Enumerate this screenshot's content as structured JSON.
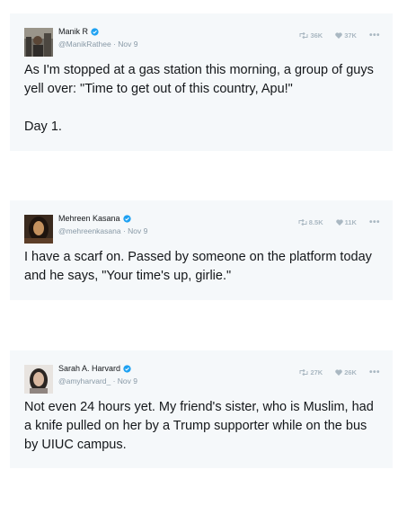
{
  "tweets": [
    {
      "name": "Manik R",
      "handle": "@ManikRathee",
      "date": "Nov 9",
      "retweets": "36K",
      "likes": "37K",
      "text": "As I'm stopped at a gas station this morning, a group of guys yell over: \"Time to get out of this country, Apu!\"\n\nDay 1."
    },
    {
      "name": "Mehreen Kasana",
      "handle": "@mehreenkasana",
      "date": "Nov 9",
      "retweets": "8.5K",
      "likes": "11K",
      "text": "I have a scarf on. Passed by someone on the platform today and he says, \"Your time's up, girlie.\""
    },
    {
      "name": "Sarah A. Harvard",
      "handle": "@amyharvard_",
      "date": "Nov 9",
      "retweets": "27K",
      "likes": "26K",
      "text": "Not even 24 hours yet. My friend's sister, who is Muslim, had a knife pulled on her by a Trump supporter while on the bus by UIUC campus."
    }
  ],
  "separator": " · ",
  "more_glyph": "•••",
  "colors": {
    "card_background": "#f5f8fa",
    "verified_blue": "#1da1f2",
    "muted": "#8899a6",
    "action_gray": "#aab8c2"
  },
  "icons": {
    "verified": "verified-badge-icon",
    "retweet": "retweet-icon",
    "like": "heart-icon",
    "more": "more-icon"
  }
}
